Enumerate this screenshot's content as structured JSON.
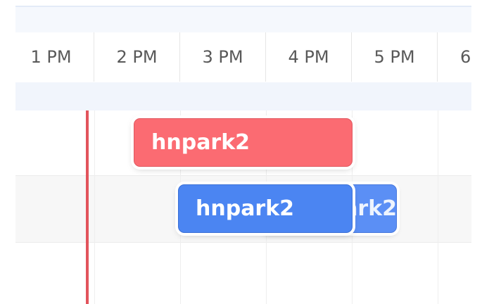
{
  "timeline": {
    "hours": [
      "1 PM",
      "2 PM",
      "3 PM",
      "4 PM",
      "5 PM",
      "6"
    ]
  },
  "events": [
    {
      "label": "hnpark2",
      "color": "#fb6b72",
      "row": 1
    },
    {
      "label": "hnpark2",
      "color": "#4b85f2",
      "row": 2
    },
    {
      "label": "hnpark2",
      "color": "#5b8ff5",
      "row": 2
    }
  ],
  "colors": {
    "now_indicator": "#e2545c",
    "header_band": "#f1f5fc"
  }
}
